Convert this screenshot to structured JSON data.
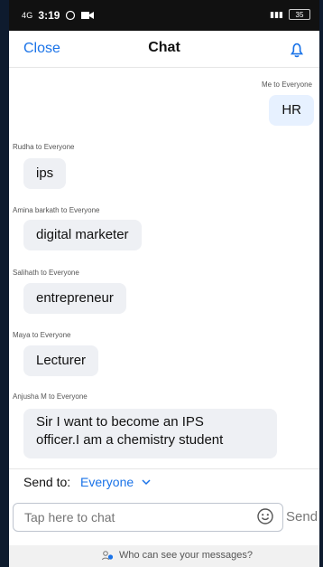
{
  "status": {
    "net": "4G",
    "time": "3:19",
    "battery": "35"
  },
  "header": {
    "close": "Close",
    "title": "Chat"
  },
  "messages": [
    {
      "sender": "Me to Everyone",
      "text": "HR"
    },
    {
      "sender": "Rudha to Everyone",
      "text": "ips"
    },
    {
      "sender": "Amina barkath to Everyone",
      "text": "digital marketer"
    },
    {
      "sender": "Salihath to Everyone",
      "text": "entrepreneur"
    },
    {
      "sender": "Maya to Everyone",
      "text": "Lecturer"
    },
    {
      "sender": "Anjusha M to Everyone",
      "text_line1": "Sir I want to become an IPS",
      "text_line2": "officer.I am a chemistry student"
    }
  ],
  "send_to": {
    "label": "Send to:",
    "target": "Everyone"
  },
  "input": {
    "placeholder": "Tap here to chat"
  },
  "send_button": "Send",
  "footer": {
    "text": "Who can see your messages?"
  },
  "colors": {
    "accent": "#1a73e8",
    "bubble": "#eef0f4"
  },
  "icons": [
    "bell-icon",
    "chevron-down-icon",
    "emoji-icon",
    "people-icon",
    "whatsapp-icon",
    "video-icon"
  ]
}
